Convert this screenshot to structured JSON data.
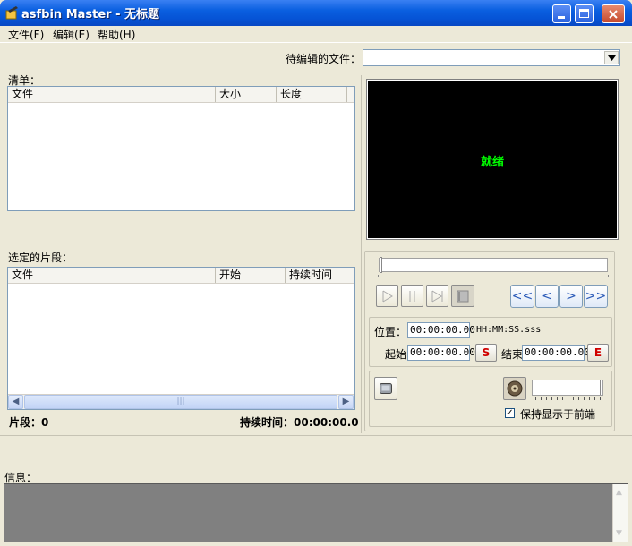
{
  "window": {
    "title": "asfbin Master - 无标题"
  },
  "menu": {
    "file": "文件(F)",
    "edit": "编辑(E)",
    "help": "帮助(H)"
  },
  "file_to_edit": {
    "label": "待编辑的文件：",
    "value": ""
  },
  "list": {
    "title": "清单：",
    "columns": [
      "文件",
      "大小",
      "长度"
    ]
  },
  "selected": {
    "title": "选定的片段：",
    "columns": [
      "文件",
      "开始",
      "持续时间"
    ]
  },
  "summary": {
    "segments_label": "片段：0",
    "duration_label": "持续时间：00:00:00.0"
  },
  "preview": {
    "status": "就绪"
  },
  "transport": {
    "play_icon": "play-icon",
    "pause_icon": "pause-icon",
    "next_icon": "skip-icon",
    "stop_icon": "stop-icon",
    "rewind": "<<",
    "back": "<",
    "forward": ">",
    "fast_forward": ">>"
  },
  "position": {
    "label": "位置：",
    "value": "00:00:00.00",
    "format": "HH:MM:SS.sss"
  },
  "range": {
    "start_label": "起始",
    "start_value": "00:00:00.00",
    "start_btn": "S",
    "end_label": "结束",
    "end_value": "00:00:00.00",
    "end_btn": "E"
  },
  "options": {
    "keep_on_top": "保持显示于前端",
    "keep_on_top_checked": true
  },
  "info": {
    "label": "信息："
  }
}
